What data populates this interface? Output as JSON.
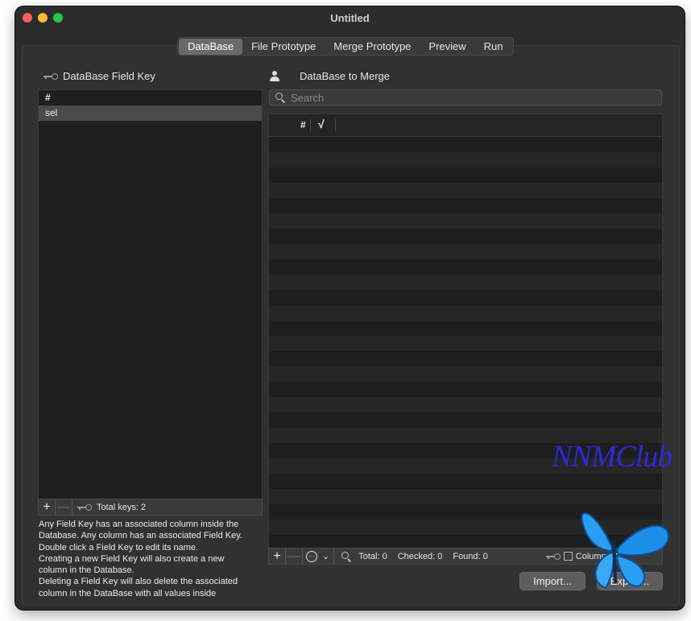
{
  "window": {
    "title": "Untitled"
  },
  "tabs": [
    "DataBase",
    "File Prototype",
    "Merge Prototype",
    "Preview",
    "Run"
  ],
  "active_tab": "DataBase",
  "left_panel": {
    "header": "DataBase Field Key",
    "column_header": "#",
    "rows": [
      "sel"
    ],
    "bottom_bar": {
      "add": "+",
      "remove": "—",
      "total": "Total keys: 2"
    },
    "help_lines": [
      "Any Field Key has an associated column inside the",
      "Database. Any column has an associated Field Key.",
      "Double click a Field Key to edit its name.",
      "Creating a new Field Key will also create a new",
      "column in the Database.",
      "Deleting a Field Key will also delete the associated",
      "column in the DataBase with all values inside"
    ]
  },
  "right_panel": {
    "header": "DataBase to Merge",
    "search": {
      "placeholder": "Search",
      "value": ""
    },
    "table_headers": [
      "#",
      "√"
    ],
    "bottom_bar": {
      "add": "+",
      "remove": "—",
      "more": "···",
      "chevron": "⌄",
      "total": "Total: 0",
      "checked": "Checked: 0",
      "found": "Found: 0",
      "columns": "Columns: 2"
    },
    "import_label": "Import...",
    "export_label": "Export..."
  },
  "watermark": "NNMClub",
  "colors": {
    "accent_tab": "#6a6a6a",
    "watermark": "#2b2bd8",
    "butterfly": "#2a9df4"
  }
}
